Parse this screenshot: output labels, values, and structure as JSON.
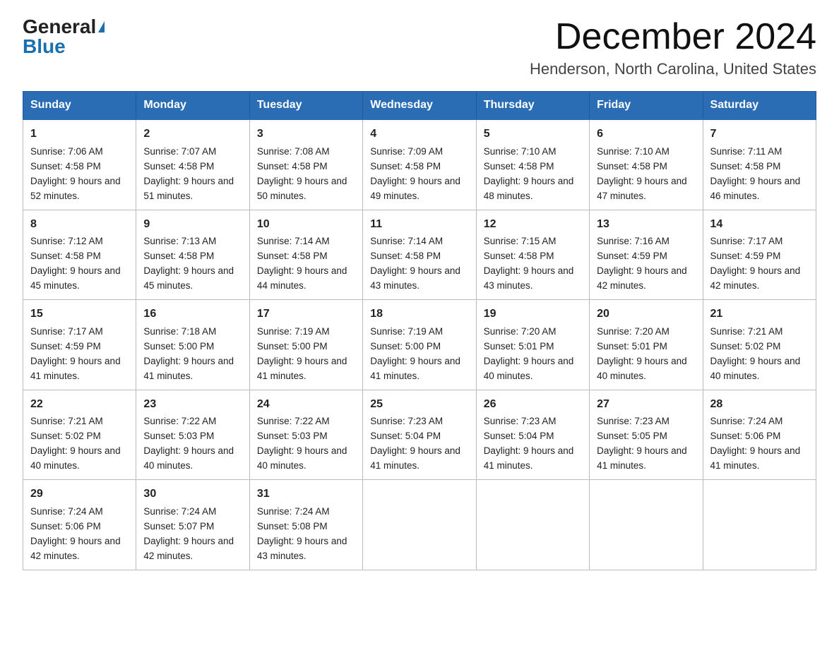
{
  "logo": {
    "general": "General",
    "blue": "Blue"
  },
  "title": {
    "month": "December 2024",
    "location": "Henderson, North Carolina, United States"
  },
  "weekdays": [
    "Sunday",
    "Monday",
    "Tuesday",
    "Wednesday",
    "Thursday",
    "Friday",
    "Saturday"
  ],
  "weeks": [
    [
      {
        "day": "1",
        "sunrise": "7:06 AM",
        "sunset": "4:58 PM",
        "daylight": "9 hours and 52 minutes."
      },
      {
        "day": "2",
        "sunrise": "7:07 AM",
        "sunset": "4:58 PM",
        "daylight": "9 hours and 51 minutes."
      },
      {
        "day": "3",
        "sunrise": "7:08 AM",
        "sunset": "4:58 PM",
        "daylight": "9 hours and 50 minutes."
      },
      {
        "day": "4",
        "sunrise": "7:09 AM",
        "sunset": "4:58 PM",
        "daylight": "9 hours and 49 minutes."
      },
      {
        "day": "5",
        "sunrise": "7:10 AM",
        "sunset": "4:58 PM",
        "daylight": "9 hours and 48 minutes."
      },
      {
        "day": "6",
        "sunrise": "7:10 AM",
        "sunset": "4:58 PM",
        "daylight": "9 hours and 47 minutes."
      },
      {
        "day": "7",
        "sunrise": "7:11 AM",
        "sunset": "4:58 PM",
        "daylight": "9 hours and 46 minutes."
      }
    ],
    [
      {
        "day": "8",
        "sunrise": "7:12 AM",
        "sunset": "4:58 PM",
        "daylight": "9 hours and 45 minutes."
      },
      {
        "day": "9",
        "sunrise": "7:13 AM",
        "sunset": "4:58 PM",
        "daylight": "9 hours and 45 minutes."
      },
      {
        "day": "10",
        "sunrise": "7:14 AM",
        "sunset": "4:58 PM",
        "daylight": "9 hours and 44 minutes."
      },
      {
        "day": "11",
        "sunrise": "7:14 AM",
        "sunset": "4:58 PM",
        "daylight": "9 hours and 43 minutes."
      },
      {
        "day": "12",
        "sunrise": "7:15 AM",
        "sunset": "4:58 PM",
        "daylight": "9 hours and 43 minutes."
      },
      {
        "day": "13",
        "sunrise": "7:16 AM",
        "sunset": "4:59 PM",
        "daylight": "9 hours and 42 minutes."
      },
      {
        "day": "14",
        "sunrise": "7:17 AM",
        "sunset": "4:59 PM",
        "daylight": "9 hours and 42 minutes."
      }
    ],
    [
      {
        "day": "15",
        "sunrise": "7:17 AM",
        "sunset": "4:59 PM",
        "daylight": "9 hours and 41 minutes."
      },
      {
        "day": "16",
        "sunrise": "7:18 AM",
        "sunset": "5:00 PM",
        "daylight": "9 hours and 41 minutes."
      },
      {
        "day": "17",
        "sunrise": "7:19 AM",
        "sunset": "5:00 PM",
        "daylight": "9 hours and 41 minutes."
      },
      {
        "day": "18",
        "sunrise": "7:19 AM",
        "sunset": "5:00 PM",
        "daylight": "9 hours and 41 minutes."
      },
      {
        "day": "19",
        "sunrise": "7:20 AM",
        "sunset": "5:01 PM",
        "daylight": "9 hours and 40 minutes."
      },
      {
        "day": "20",
        "sunrise": "7:20 AM",
        "sunset": "5:01 PM",
        "daylight": "9 hours and 40 minutes."
      },
      {
        "day": "21",
        "sunrise": "7:21 AM",
        "sunset": "5:02 PM",
        "daylight": "9 hours and 40 minutes."
      }
    ],
    [
      {
        "day": "22",
        "sunrise": "7:21 AM",
        "sunset": "5:02 PM",
        "daylight": "9 hours and 40 minutes."
      },
      {
        "day": "23",
        "sunrise": "7:22 AM",
        "sunset": "5:03 PM",
        "daylight": "9 hours and 40 minutes."
      },
      {
        "day": "24",
        "sunrise": "7:22 AM",
        "sunset": "5:03 PM",
        "daylight": "9 hours and 40 minutes."
      },
      {
        "day": "25",
        "sunrise": "7:23 AM",
        "sunset": "5:04 PM",
        "daylight": "9 hours and 41 minutes."
      },
      {
        "day": "26",
        "sunrise": "7:23 AM",
        "sunset": "5:04 PM",
        "daylight": "9 hours and 41 minutes."
      },
      {
        "day": "27",
        "sunrise": "7:23 AM",
        "sunset": "5:05 PM",
        "daylight": "9 hours and 41 minutes."
      },
      {
        "day": "28",
        "sunrise": "7:24 AM",
        "sunset": "5:06 PM",
        "daylight": "9 hours and 41 minutes."
      }
    ],
    [
      {
        "day": "29",
        "sunrise": "7:24 AM",
        "sunset": "5:06 PM",
        "daylight": "9 hours and 42 minutes."
      },
      {
        "day": "30",
        "sunrise": "7:24 AM",
        "sunset": "5:07 PM",
        "daylight": "9 hours and 42 minutes."
      },
      {
        "day": "31",
        "sunrise": "7:24 AM",
        "sunset": "5:08 PM",
        "daylight": "9 hours and 43 minutes."
      },
      null,
      null,
      null,
      null
    ]
  ]
}
